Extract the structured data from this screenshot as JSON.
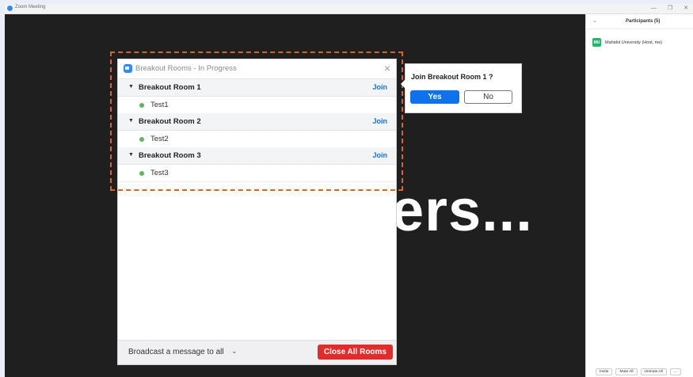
{
  "window": {
    "title": "Zoom Meeting",
    "controls": [
      "—",
      "❐",
      "✕"
    ]
  },
  "video": {
    "overlay_text": "ers..."
  },
  "participants": {
    "title": "Participants (5)",
    "collapse_glyph": "⌄",
    "list": [
      {
        "initials": "MU",
        "name": "Mahidol University (Host, me)"
      }
    ],
    "footer": [
      "Invite",
      "Mute All",
      "Unmute All",
      "..."
    ]
  },
  "breakout": {
    "title": "Breakout Rooms - In Progress",
    "close_glyph": "×",
    "rooms": [
      {
        "name": "Breakout Room 1",
        "join": "Join",
        "members": [
          "Test1"
        ]
      },
      {
        "name": "Breakout Room 2",
        "join": "Join",
        "members": [
          "Test2"
        ]
      },
      {
        "name": "Breakout Room 3",
        "join": "Join",
        "members": [
          "Test3"
        ]
      }
    ],
    "broadcast_label": "Broadcast a message to all",
    "close_all_label": "Close All Rooms"
  },
  "join_popup": {
    "question": "Join Breakout Room 1 ?",
    "yes": "Yes",
    "no": "No"
  },
  "colors": {
    "accent": "#0e72ed",
    "danger": "#e22c2c",
    "highlight": "#d9651b",
    "status_green": "#5cb85c"
  }
}
